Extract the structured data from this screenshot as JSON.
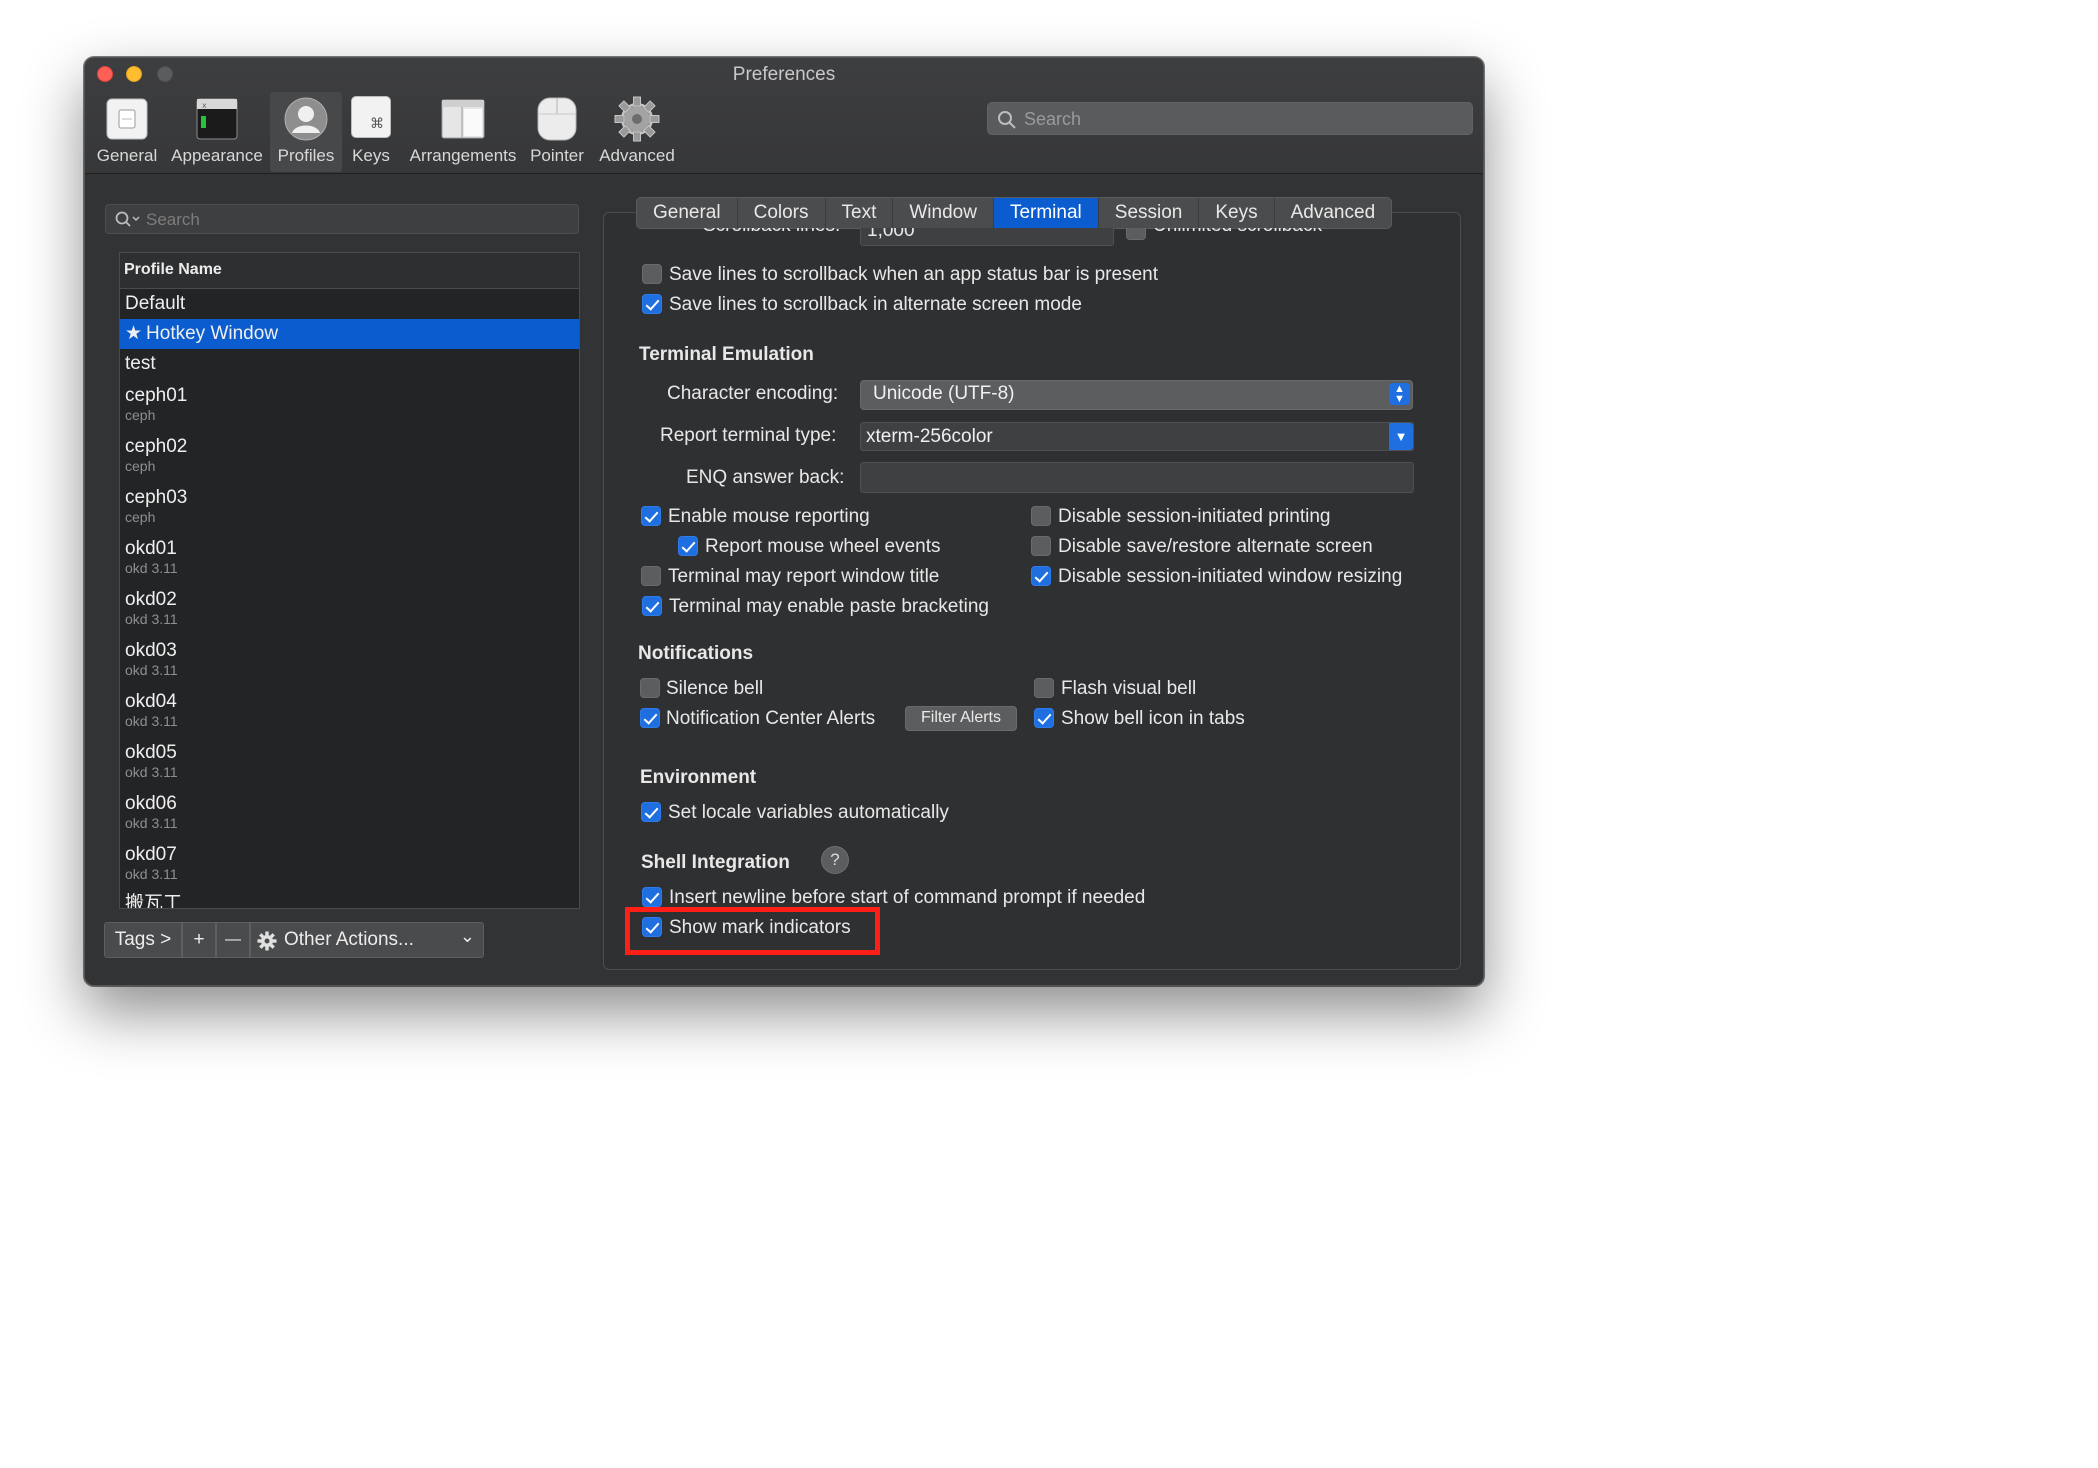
{
  "window": {
    "title": "Preferences"
  },
  "toolbar": {
    "items": [
      {
        "label": "General"
      },
      {
        "label": "Appearance"
      },
      {
        "label": "Profiles"
      },
      {
        "label": "Keys",
        "glyph": "⌘"
      },
      {
        "label": "Arrangements"
      },
      {
        "label": "Pointer"
      },
      {
        "label": "Advanced"
      }
    ],
    "active": "Profiles",
    "search_placeholder": "Search"
  },
  "profiles": {
    "search_placeholder": "Search",
    "column_header": "Profile Name",
    "rows": [
      {
        "name": "Default",
        "tag": ""
      },
      {
        "name": "Hotkey Window",
        "tag": "",
        "starred": true,
        "selected": true
      },
      {
        "name": "test",
        "tag": ""
      },
      {
        "name": "ceph01",
        "tag": "ceph"
      },
      {
        "name": "ceph02",
        "tag": "ceph"
      },
      {
        "name": "ceph03",
        "tag": "ceph"
      },
      {
        "name": "okd01",
        "tag": "okd 3.11"
      },
      {
        "name": "okd02",
        "tag": "okd 3.11"
      },
      {
        "name": "okd03",
        "tag": "okd 3.11"
      },
      {
        "name": "okd04",
        "tag": "okd 3.11"
      },
      {
        "name": "okd05",
        "tag": "okd 3.11"
      },
      {
        "name": "okd06",
        "tag": "okd 3.11"
      },
      {
        "name": "okd07",
        "tag": "okd 3.11"
      },
      {
        "name": "搬瓦工",
        "tag": ""
      }
    ],
    "bottom": {
      "tags": "Tags >",
      "add": "+",
      "remove": "—",
      "other_actions": "Other Actions...",
      "dropdown": "⌄"
    }
  },
  "tabs": [
    "General",
    "Colors",
    "Text",
    "Window",
    "Terminal",
    "Session",
    "Keys",
    "Advanced"
  ],
  "active_tab": "Terminal",
  "scrollback": {
    "label": "Scrollback lines:",
    "value": "1,000",
    "unlimited_label": "Unlimited scrollback"
  },
  "options": {
    "save_status_bar": {
      "label": "Save lines to scrollback when an app status bar is present",
      "checked": false
    },
    "save_alt_screen": {
      "label": "Save lines to scrollback in alternate screen mode",
      "checked": true
    }
  },
  "terminal_emulation": {
    "heading": "Terminal Emulation",
    "char_encoding_label": "Character encoding:",
    "char_encoding_value": "Unicode (UTF-8)",
    "term_type_label": "Report terminal type:",
    "term_type_value": "xterm-256color",
    "enq_label": "ENQ answer back:",
    "enq_value": "",
    "enable_mouse": {
      "label": "Enable mouse reporting",
      "checked": true
    },
    "mouse_wheel": {
      "label": "Report mouse wheel events",
      "checked": true
    },
    "report_title": {
      "label": "Terminal may report window title",
      "checked": false
    },
    "paste_bracketing": {
      "label": "Terminal may enable paste bracketing",
      "checked": true
    },
    "disable_printing": {
      "label": "Disable session-initiated printing",
      "checked": false
    },
    "disable_save_restore": {
      "label": "Disable save/restore alternate screen",
      "checked": false
    },
    "disable_resizing": {
      "label": "Disable session-initiated window resizing",
      "checked": true
    }
  },
  "notifications": {
    "heading": "Notifications",
    "silence_bell": {
      "label": "Silence bell",
      "checked": false
    },
    "flash_bell": {
      "label": "Flash visual bell",
      "checked": false
    },
    "nc_alerts": {
      "label": "Notification Center Alerts",
      "checked": true
    },
    "filter_alerts": "Filter Alerts",
    "bell_icon": {
      "label": "Show bell icon in tabs",
      "checked": true
    }
  },
  "environment": {
    "heading": "Environment",
    "set_locale": {
      "label": "Set locale variables automatically",
      "checked": true
    }
  },
  "shell_integration": {
    "heading": "Shell Integration",
    "help": "?",
    "insert_newline": {
      "label": "Insert newline before start of command prompt if needed",
      "checked": true
    },
    "show_marks": {
      "label": "Show mark indicators",
      "checked": true
    }
  },
  "colors": {
    "accent": "#0b5ccf",
    "highlight": "#ff1f17",
    "window_bg": "#323335"
  }
}
